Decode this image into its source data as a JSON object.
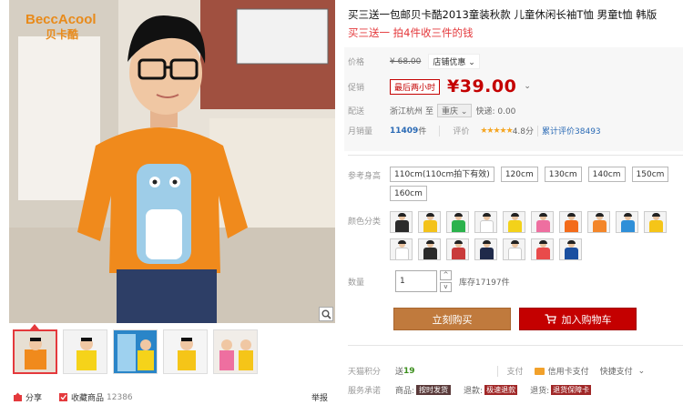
{
  "brand": {
    "logo_text": "BeccAcool",
    "logo_sub": "贝卡酷"
  },
  "product": {
    "title": "买三送一包邮贝卡酷2013童装秋款 儿童休闲长袖T恤 男童t恤 韩版",
    "subtitle": "买三送一 拍4件收三件的钱"
  },
  "price": {
    "label": "价格",
    "original": "¥ 68.00",
    "store_promo": "店铺优惠",
    "promo_label": "促销",
    "promo_badge": "最后两小时",
    "promo_price": "¥39.00"
  },
  "shipping": {
    "label": "配送",
    "from": "浙江杭州",
    "to_word": "至",
    "to": "重庆",
    "express": "快递: 0.00"
  },
  "sales": {
    "label": "月销量",
    "count": "11409",
    "unit": "件",
    "rating_label": "评价",
    "stars": "★★★★★",
    "score": "4.8分",
    "reviews": "累计评价38493"
  },
  "size": {
    "label": "参考身高",
    "options": [
      "110cm(110cm拍下有效)",
      "120cm",
      "130cm",
      "140cm",
      "150cm",
      "160cm"
    ]
  },
  "colors": {
    "label": "颜色分类",
    "swatches": [
      "#2b2b2b",
      "#f3c21a",
      "#2bb24c",
      "#ffffff",
      "#f3d21a",
      "#ee6fa0",
      "#f36b1a",
      "#f3862a",
      "#2f8fd8",
      "#f5c518",
      "#ffffff",
      "#2b2b2b",
      "#c93b3b",
      "#1f2a4a",
      "#ffffff",
      "#e94b4b",
      "#1a4fa0"
    ]
  },
  "quantity": {
    "label": "数量",
    "value": "1",
    "up": "^",
    "down": "v",
    "stock": "库存17197件"
  },
  "actions": {
    "buy": "立刻购买",
    "cart": "加入购物车"
  },
  "tmall": {
    "points_label": "天猫积分",
    "points_prefix": "送",
    "points": "19",
    "pay_label": "支付",
    "credit_pay": "信用卡支付",
    "quick_pay": "快捷支付"
  },
  "service": {
    "label": "服务承诺",
    "goods_label": "商品:",
    "goods_tag": "按时发货",
    "refund1_label": "退款:",
    "refund1_tag": "极速退款",
    "refund2_label": "退货:",
    "refund2_tag": "退货保障卡"
  },
  "share": {
    "share_label": "分享",
    "fav_label": "收藏商品",
    "fav_count": "12386",
    "report": "举报"
  }
}
